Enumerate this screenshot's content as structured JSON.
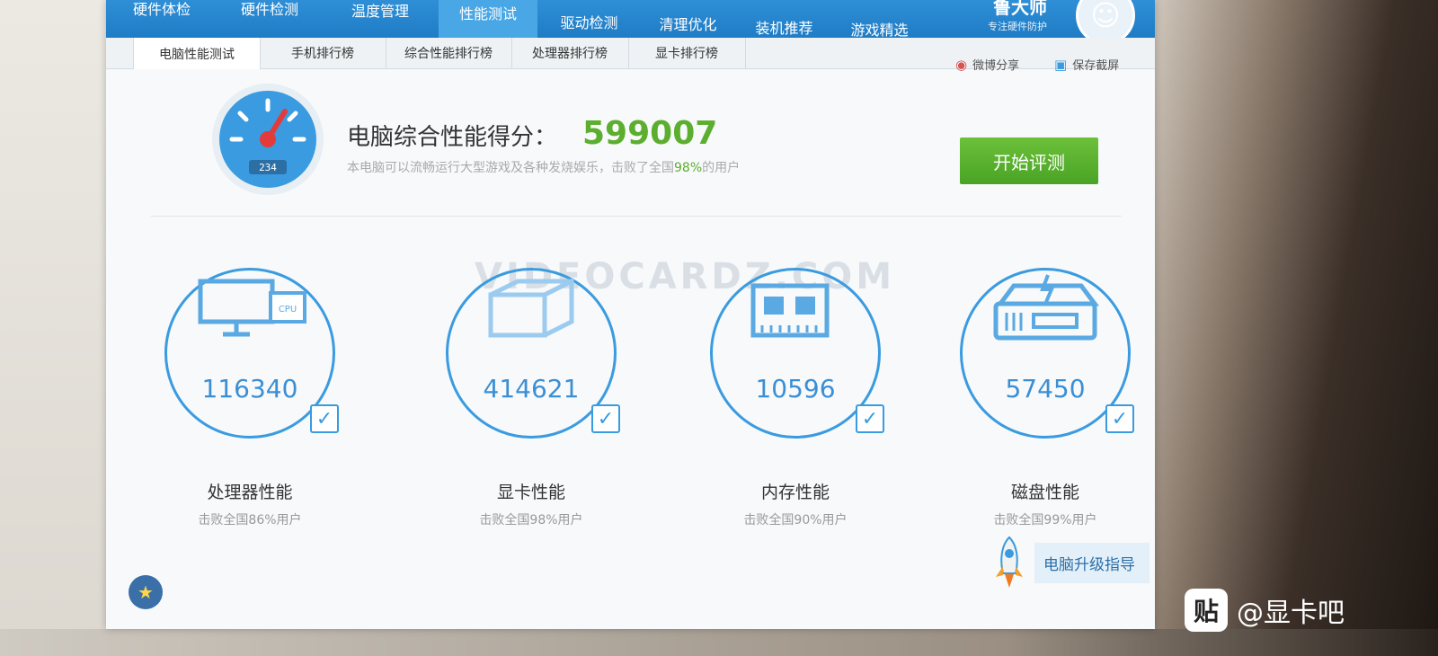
{
  "nav": {
    "items": [
      "硬件体检",
      "硬件检测",
      "温度管理",
      "性能测试",
      "驱动检测",
      "清理优化",
      "装机推荐",
      "游戏精选"
    ],
    "active": "性能测试"
  },
  "brand": {
    "title": "鲁大师",
    "subtitle": "专注硬件防护"
  },
  "subtabs": [
    "电脑性能测试",
    "手机排行榜",
    "综合性能排行榜",
    "处理器排行榜",
    "显卡排行榜"
  ],
  "share": {
    "weibo": "微博分享",
    "screenshot": "保存截屏"
  },
  "score": {
    "label": "电脑综合性能得分：",
    "value": "599007",
    "desc_prefix": "本电脑可以流畅运行大型游戏及各种发烧娱乐，击败了全国",
    "desc_percent": "98%",
    "desc_suffix": "的用户",
    "gauge_digits": "234"
  },
  "start_button": "开始评测",
  "watermark": "VIDEOCARDZ.COM",
  "metrics": [
    {
      "value": "116340",
      "name": "处理器性能",
      "sub": "击败全国86%用户",
      "icon": "monitor-cpu-icon"
    },
    {
      "value": "414621",
      "name": "显卡性能",
      "sub": "击败全国98%用户",
      "icon": "cube-icon"
    },
    {
      "value": "10596",
      "name": "内存性能",
      "sub": "击败全国90%用户",
      "icon": "memory-chip-icon"
    },
    {
      "value": "57450",
      "name": "磁盘性能",
      "sub": "击败全国99%用户",
      "icon": "disk-icon"
    }
  ],
  "upgrade": "电脑升级指导",
  "tieba": {
    "icon": "贴",
    "label": "@显卡吧"
  },
  "colors": {
    "nav": "#1f7cc6",
    "score": "#5cae2e",
    "accent": "#3a9be0",
    "button": "#4aa325"
  }
}
